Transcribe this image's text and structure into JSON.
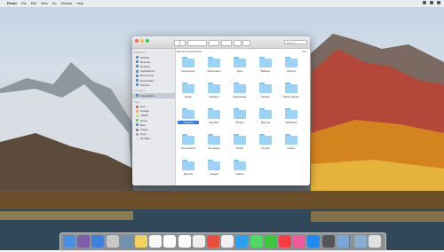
{
  "menubar": {
    "apple": "",
    "items": [
      "Finder",
      "File",
      "Edit",
      "View",
      "Go",
      "Window",
      "Help"
    ]
  },
  "window": {
    "title": "",
    "search_placeholder": "Search",
    "path_label": "Monterey Downloads",
    "path_right": "Info"
  },
  "sidebar": {
    "sections": [
      {
        "header": "Favorites",
        "items": [
          "AirDrop",
          "Recents",
          "Desktop",
          "Applications",
          "Documents",
          "Downloads",
          "Pictures"
        ]
      },
      {
        "header": "Locations",
        "items": [
          "iCloud Drive"
        ]
      },
      {
        "header": "Tags",
        "items": [
          "Red",
          "Orange",
          "Yellow",
          "Green",
          "Blue",
          "Purple",
          "Gray",
          "All Tags..."
        ]
      }
    ],
    "tag_colors": [
      "#e5473b",
      "#f0a030",
      "#f3d13b",
      "#5ac54f",
      "#3b82e0",
      "#a257c9",
      "#9b9b9b",
      "#dddddd"
    ]
  },
  "files": [
    "Documents",
    "Automation",
    "Apps",
    "Backup",
    "Archive",
    "Notes",
    "Desktop",
    "Downloads",
    "Movies",
    "Music Library",
    "Projects",
    "Dropbox",
    "Photos",
    "Reports",
    "Websites",
    "Screenshots",
    "Templates",
    "Drafts",
    "Scripts",
    "Library",
    "Exports",
    "Images",
    "Clients"
  ],
  "selected_file_index": 10
}
